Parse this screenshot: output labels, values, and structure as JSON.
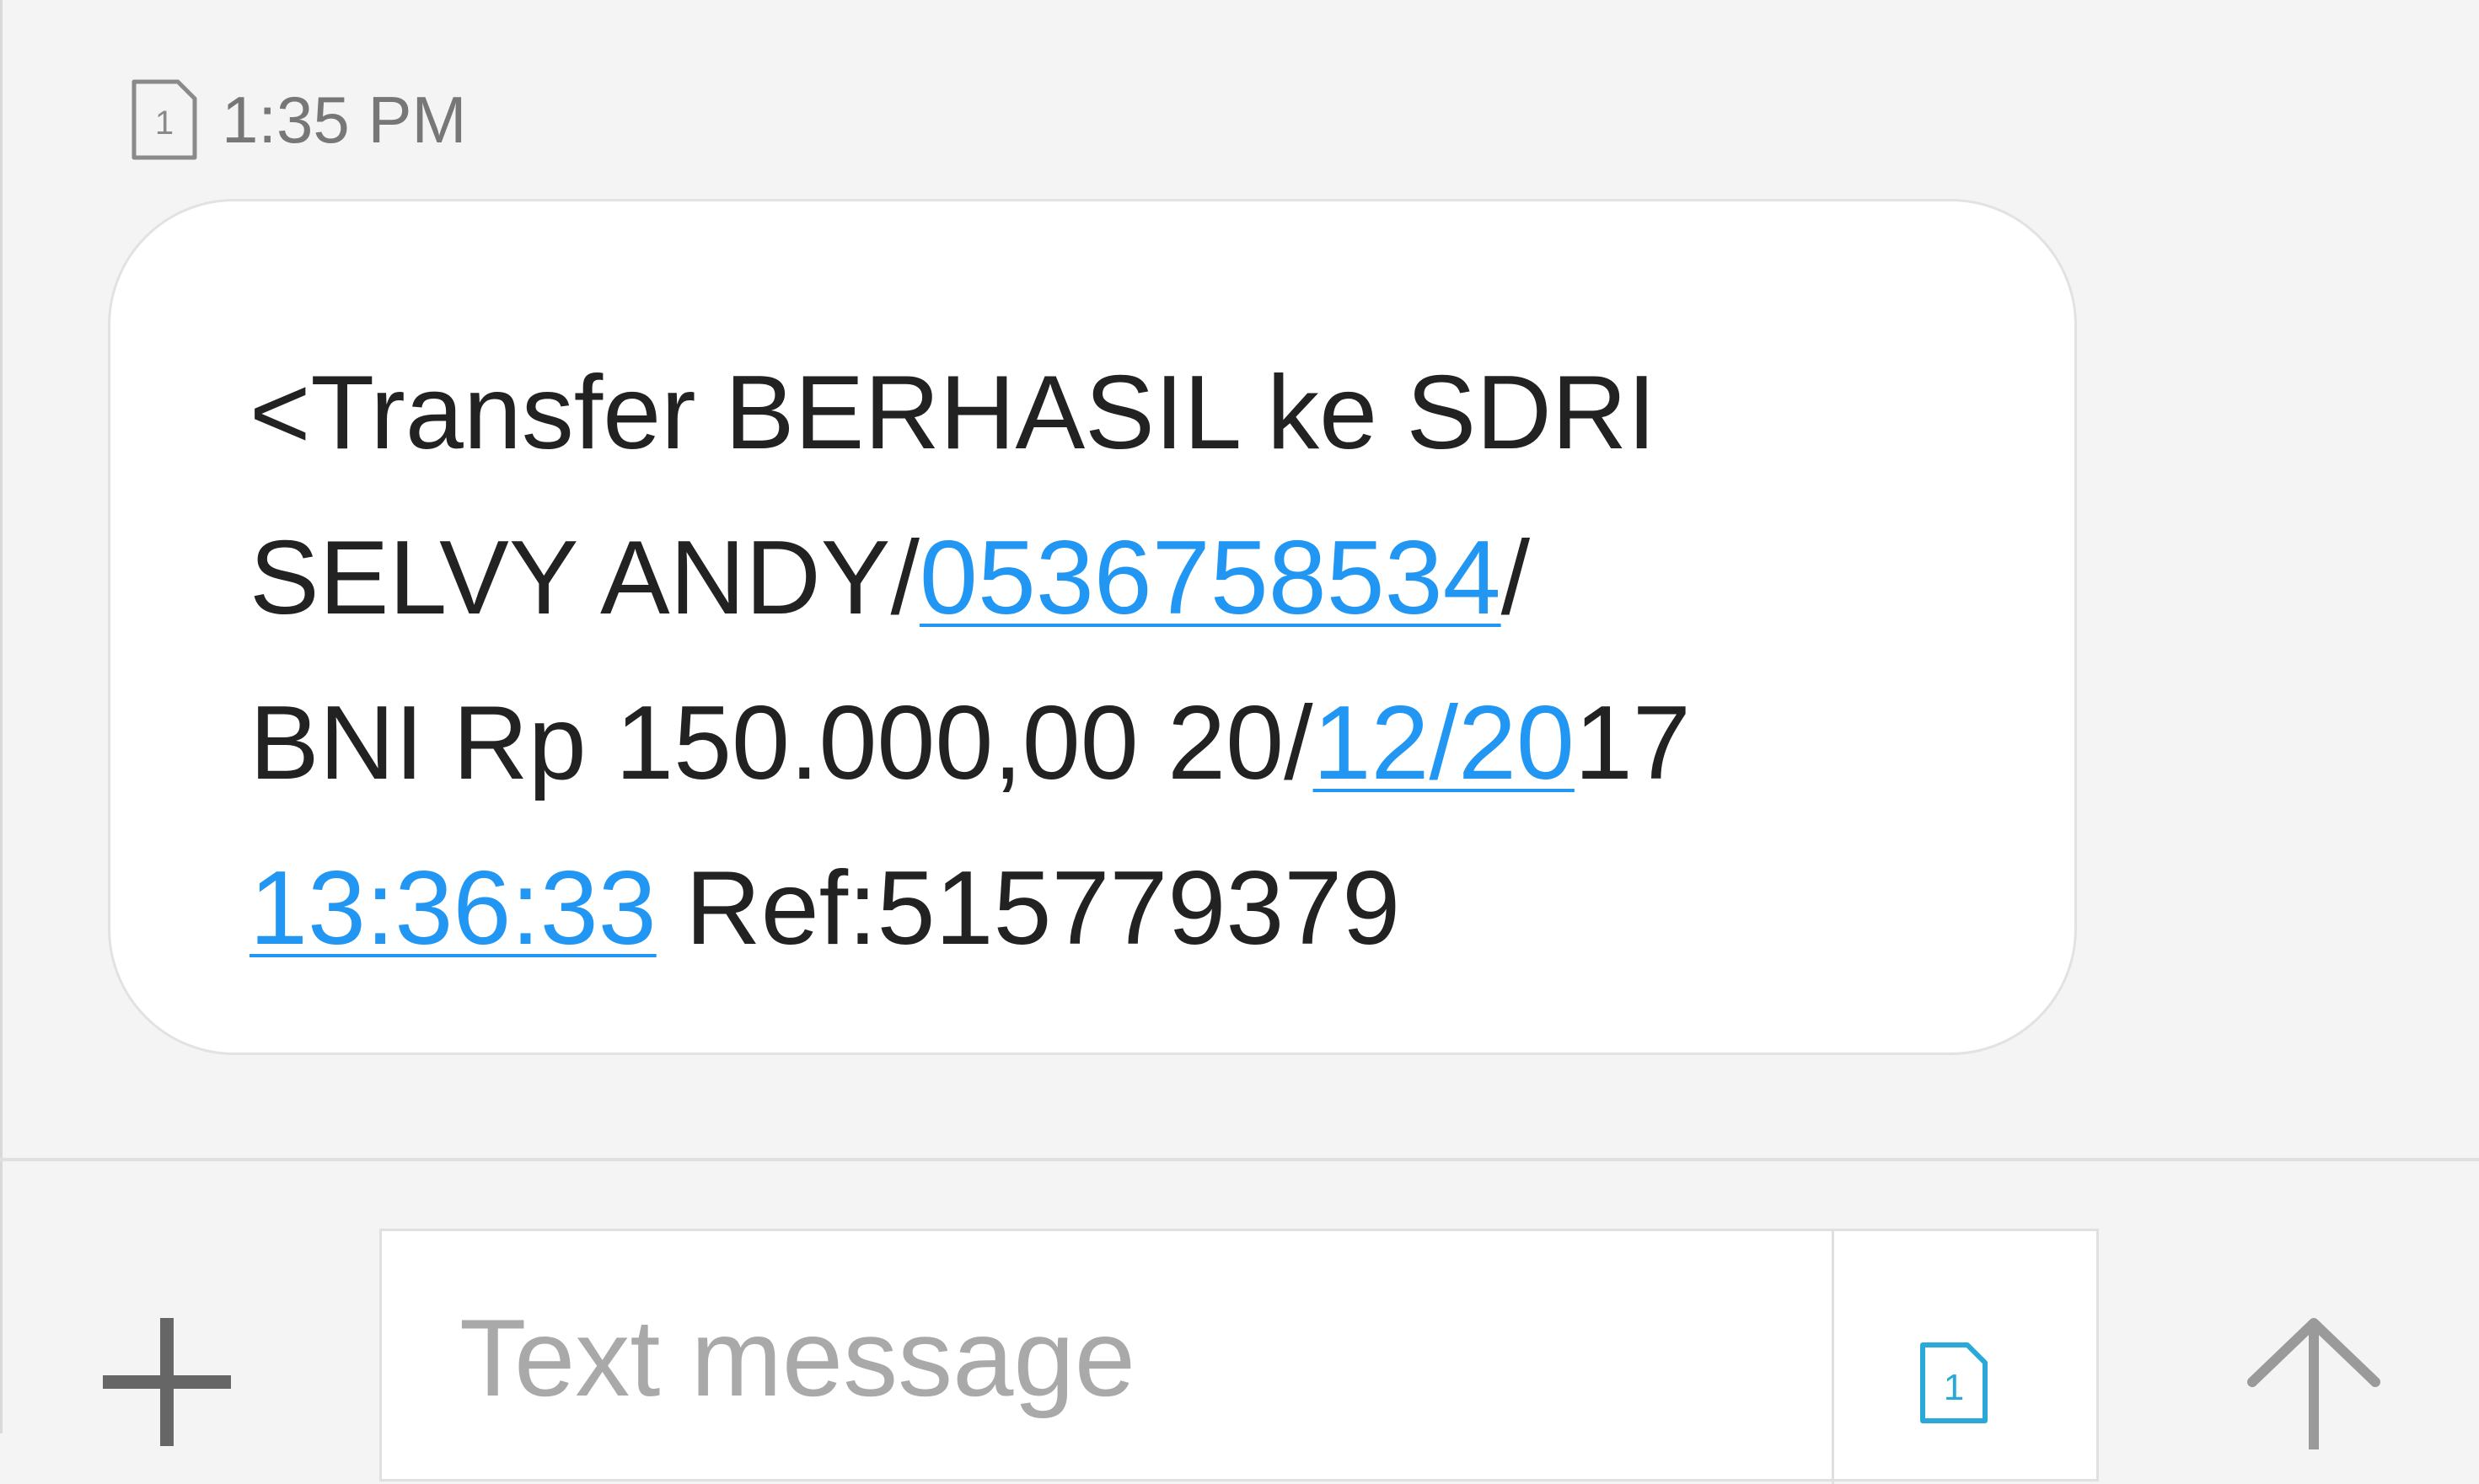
{
  "message": {
    "sim_number": "1",
    "time": "1:35 PM",
    "lines": [
      [
        {
          "text": "<Transfer BERHASIL ke SDRI",
          "link": false
        }
      ],
      [
        {
          "text": "SELVY ANDY/",
          "link": false
        },
        {
          "text": "0536758534",
          "link": true
        },
        {
          "text": "/",
          "link": false
        }
      ],
      [
        {
          "text": "BNI Rp 150.000,00 20/",
          "link": false
        },
        {
          "text": "12/20",
          "link": true
        },
        {
          "text": "17",
          "link": false
        }
      ],
      [
        {
          "text": "13:36:33",
          "link": true
        },
        {
          "text": " Ref:515779379",
          "link": false
        }
      ]
    ]
  },
  "compose": {
    "placeholder": "Text message",
    "sim_number": "1"
  },
  "colors": {
    "background": "#f4f4f4",
    "bubble": "#ffffff",
    "link": "#2196f3",
    "text": "#222222",
    "meta_text": "#777777",
    "placeholder": "#a9a9a9"
  },
  "icons": {
    "sim": "sim-card-icon",
    "add": "plus-icon",
    "send": "arrow-up-icon"
  }
}
